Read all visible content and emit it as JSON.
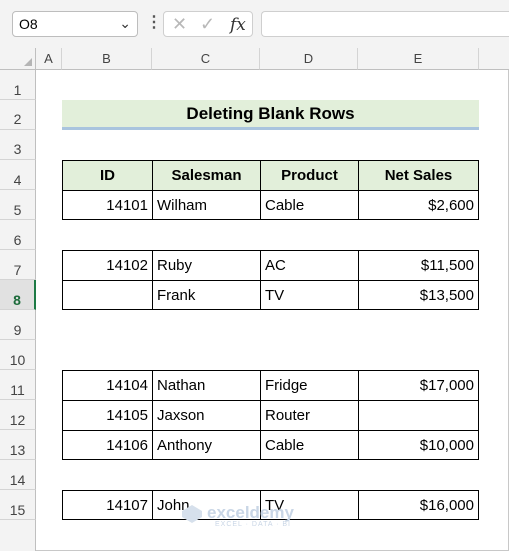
{
  "formula_bar": {
    "name_box": "O8",
    "formula": "",
    "fx_symbol": "fx"
  },
  "columns": [
    "A",
    "B",
    "C",
    "D",
    "E"
  ],
  "rows": [
    "1",
    "2",
    "3",
    "4",
    "5",
    "6",
    "7",
    "8",
    "9",
    "10",
    "11",
    "12",
    "13",
    "14",
    "15"
  ],
  "active_row": "8",
  "sheet": {
    "title": "Deleting Blank Rows",
    "headers": [
      "ID",
      "Salesman",
      "Product",
      "Net Sales"
    ],
    "r5": {
      "id": "14101",
      "salesman": "Wilham",
      "product": "Cable",
      "sales": "$2,600"
    },
    "r7": {
      "id": "14102",
      "salesman": "Ruby",
      "product": "AC",
      "sales": "$11,500"
    },
    "r8": {
      "id": "",
      "salesman": "Frank",
      "product": "TV",
      "sales": "$13,500"
    },
    "r11": {
      "id": "14104",
      "salesman": "Nathan",
      "product": "Fridge",
      "sales": "$17,000"
    },
    "r12": {
      "id": "14105",
      "salesman": "Jaxson",
      "product": "Router",
      "sales": ""
    },
    "r13": {
      "id": "14106",
      "salesman": "Anthony",
      "product": "Cable",
      "sales": "$10,000"
    },
    "r15": {
      "id": "14107",
      "salesman": "John",
      "product": "TV",
      "sales": "$16,000"
    }
  },
  "watermark": {
    "name": "exceldemy",
    "tagline": "EXCEL · DATA · BI"
  },
  "colors": {
    "header_fill": "#e2efda",
    "active_row": "#1d7a45"
  }
}
